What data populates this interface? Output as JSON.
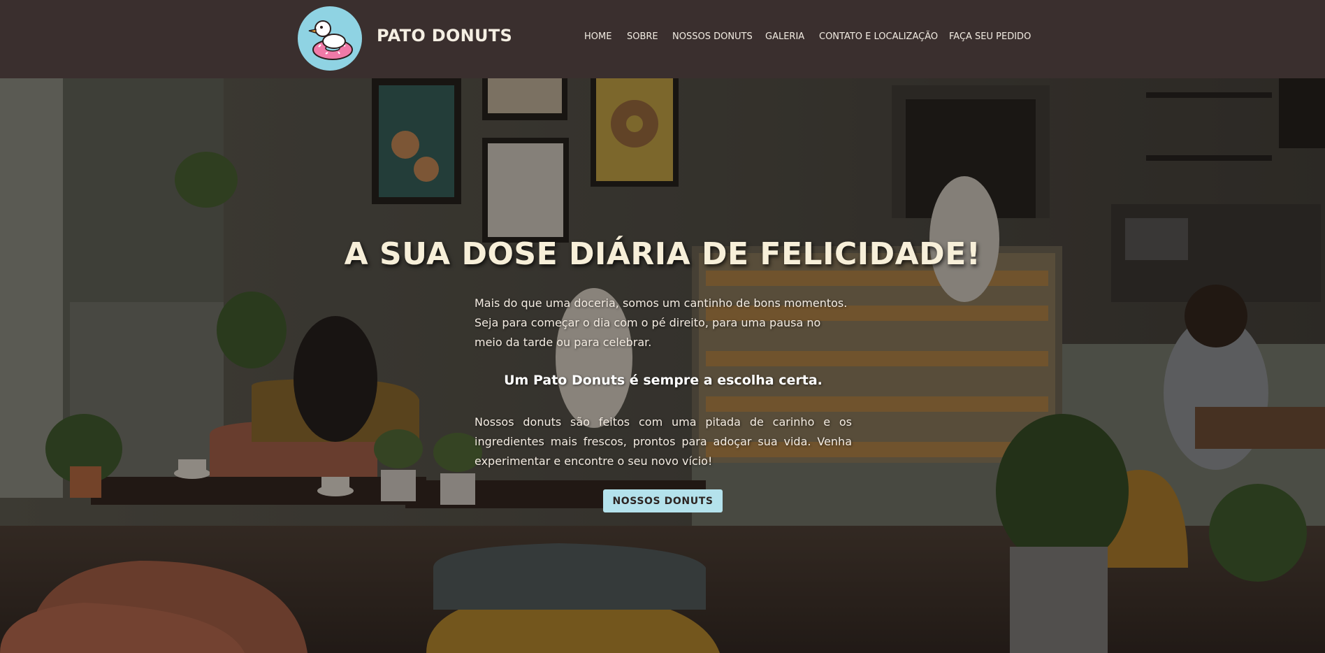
{
  "header": {
    "logo_alt": "Pato Donuts duck logo",
    "brand": "PATO DONUTS",
    "nav": [
      {
        "label": "HOME"
      },
      {
        "label": "SOBRE"
      },
      {
        "label": "NOSSOS DONUTS"
      },
      {
        "label": "GALERIA"
      },
      {
        "label": "CONTATO E LOCALIZAÇÃO"
      },
      {
        "label": "FAÇA SEU PEDIDO"
      }
    ]
  },
  "hero": {
    "title": "A SUA DOSE DIÁRIA DE FELICIDADE!",
    "paragraph1": "Mais do que uma doceria, somos um cantinho de bons momentos. Seja para começar o dia com o pé direito, para uma pausa no meio da tarde ou para celebrar.",
    "tagline": "Um Pato Donuts é sempre a escolha certa.",
    "paragraph2": "Nossos donuts são feitos com uma pitada de carinho e os ingredientes mais frescos, prontos para adoçar sua vida. Venha experimentar e encontre o seu novo vício!",
    "cta_label": "NOSSOS DONUTS",
    "background_icon": "donut-shop-photo"
  },
  "colors": {
    "header_bg": "#3a2f2e",
    "logo_bg": "#8fd3e3",
    "accent_button": "#b4e2ec",
    "title_text": "#f7efd9"
  }
}
